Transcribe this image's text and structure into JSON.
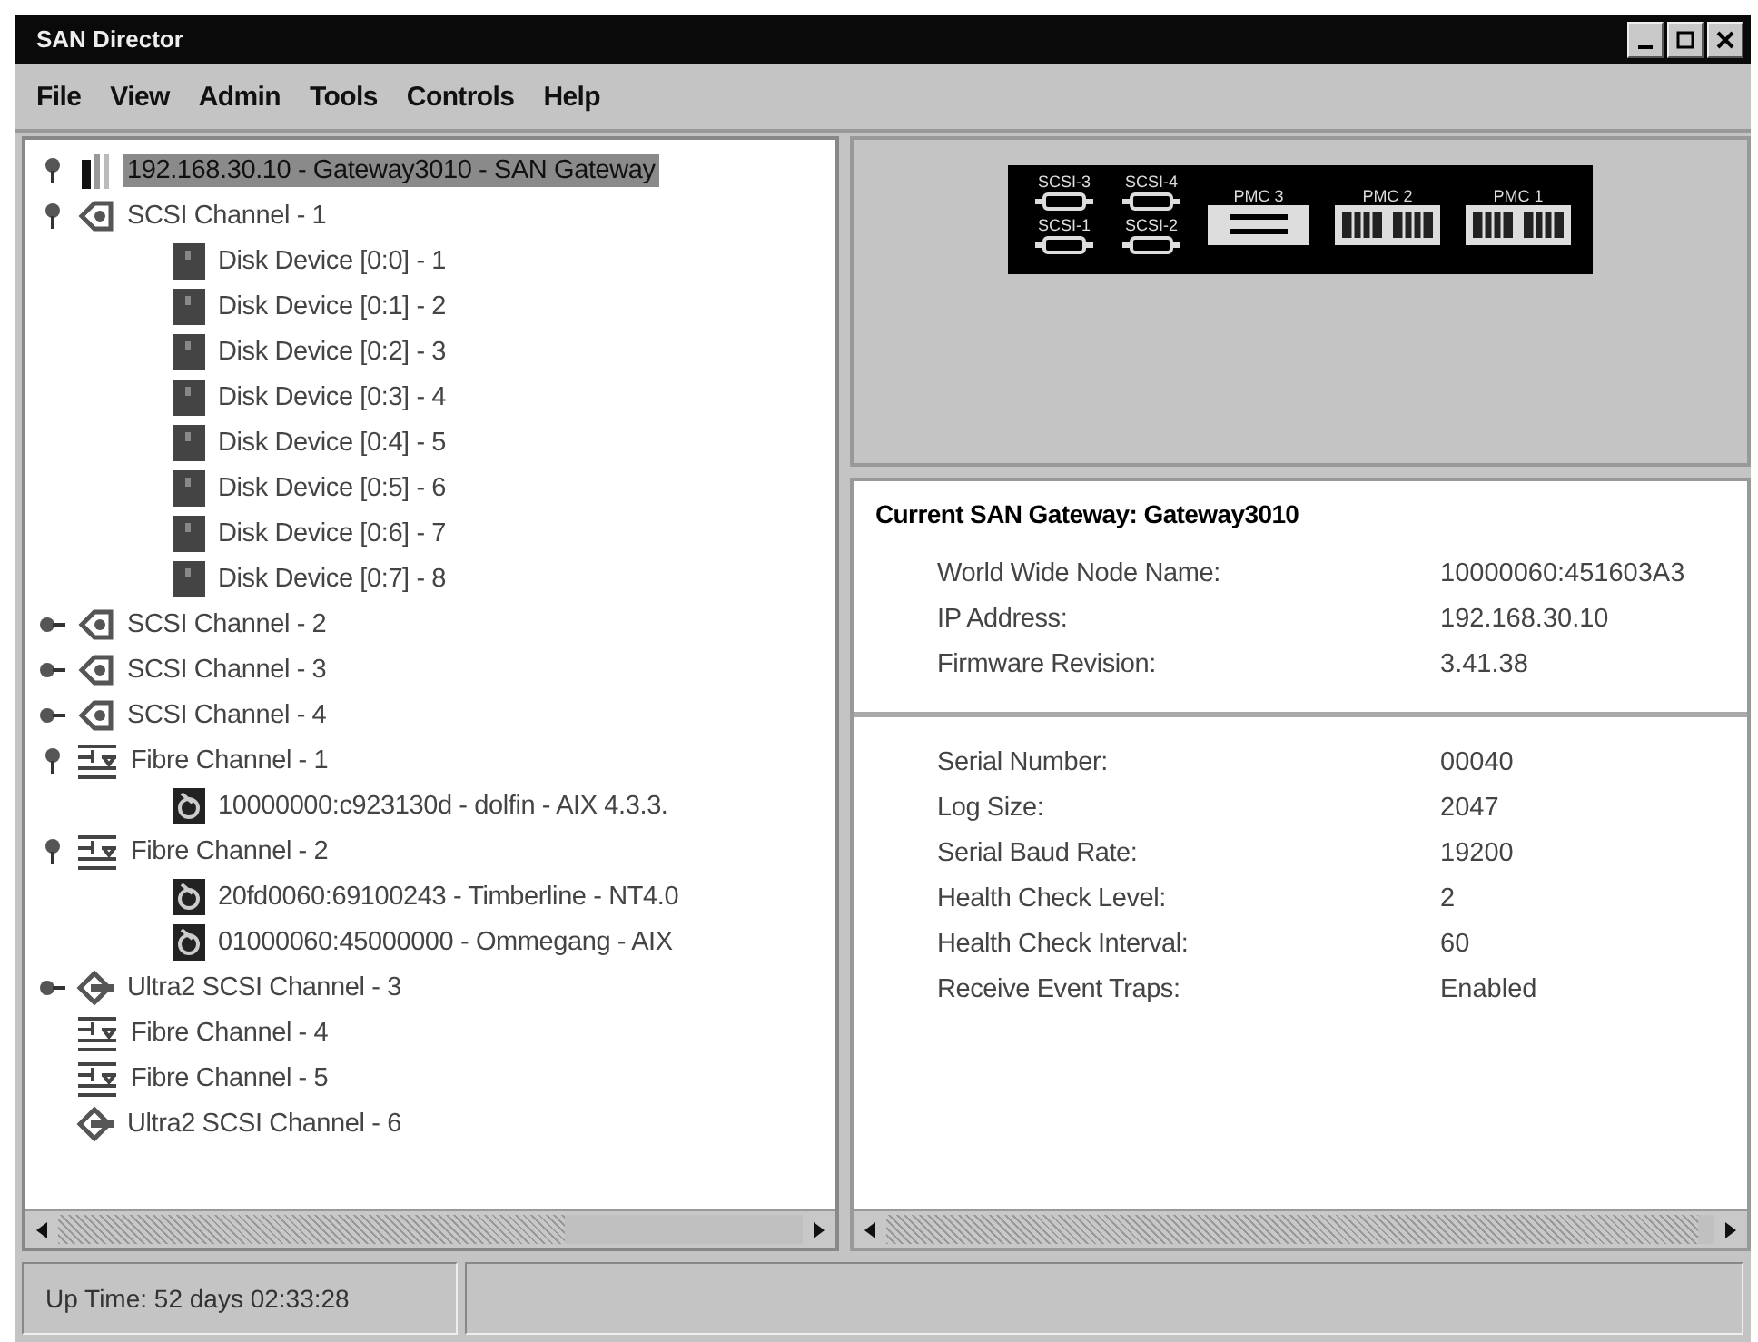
{
  "window": {
    "title": "SAN Director"
  },
  "menu": [
    "File",
    "View",
    "Admin",
    "Tools",
    "Controls",
    "Help"
  ],
  "tree": [
    {
      "kind": "gateway",
      "label": "192.168.30.10 - Gateway3010 - SAN Gateway",
      "expanded": true,
      "selected": true
    },
    {
      "kind": "scsi",
      "label": "SCSI Channel - 1",
      "expanded": true,
      "selected": false,
      "children": [
        {
          "kind": "disk",
          "label": "Disk Device [0:0] - 1",
          "selected": false
        },
        {
          "kind": "disk",
          "label": "Disk Device [0:1] - 2",
          "selected": false
        },
        {
          "kind": "disk",
          "label": "Disk Device [0:2] - 3",
          "selected": false
        },
        {
          "kind": "disk",
          "label": "Disk Device [0:3] - 4",
          "selected": false
        },
        {
          "kind": "disk",
          "label": "Disk Device [0:4] - 5",
          "selected": false
        },
        {
          "kind": "disk",
          "label": "Disk Device [0:5] - 6",
          "selected": false
        },
        {
          "kind": "disk",
          "label": "Disk Device [0:6] - 7",
          "selected": false
        },
        {
          "kind": "disk",
          "label": "Disk Device [0:7] - 8",
          "selected": false
        }
      ]
    },
    {
      "kind": "scsi",
      "label": "SCSI Channel - 2",
      "expanded": false,
      "selected": false
    },
    {
      "kind": "scsi",
      "label": "SCSI Channel - 3",
      "expanded": false,
      "selected": false
    },
    {
      "kind": "scsi",
      "label": "SCSI Channel - 4",
      "expanded": false,
      "selected": false
    },
    {
      "kind": "fibre",
      "label": "Fibre Channel - 1",
      "expanded": true,
      "selected": false,
      "children": [
        {
          "kind": "host",
          "label": "10000000:c923130d -  dolfin -   AIX 4.3.3.",
          "selected": false
        }
      ]
    },
    {
      "kind": "fibre",
      "label": "Fibre Channel - 2",
      "expanded": true,
      "selected": false,
      "children": [
        {
          "kind": "host",
          "label": "20fd0060:69100243 -  Timberline -  NT4.0",
          "selected": false
        },
        {
          "kind": "host",
          "label": "01000060:45000000 -  Ommegang  - AIX",
          "selected": false
        }
      ]
    },
    {
      "kind": "ultra2",
      "label": "Ultra2 SCSI Channel - 3",
      "expanded": false,
      "selected": false
    },
    {
      "kind": "fibre",
      "label": "Fibre Channel - 4",
      "selected": false
    },
    {
      "kind": "fibre",
      "label": "Fibre Channel - 5",
      "selected": false
    },
    {
      "kind": "ultra2",
      "label": "Ultra2 SCSI Channel - 6",
      "selected": false
    }
  ],
  "device_panel": {
    "ports": [
      {
        "kind": "scsi",
        "label": "SCSI-3"
      },
      {
        "kind": "scsi",
        "label": "SCSI-4"
      },
      {
        "kind": "scsi",
        "label": "SCSI-1"
      },
      {
        "kind": "scsi",
        "label": "SCSI-2"
      },
      {
        "kind": "pmc_serial",
        "label": "PMC 3"
      },
      {
        "kind": "pmc_fibre",
        "label": "PMC 2"
      },
      {
        "kind": "pmc_fibre",
        "label": "PMC 1"
      }
    ]
  },
  "details": {
    "title": "Current SAN Gateway:  Gateway3010",
    "sections": [
      [
        {
          "label": "World Wide Node Name:",
          "value": "10000060:451603A3"
        },
        {
          "label": "IP Address:",
          "value": "192.168.30.10"
        },
        {
          "label": "Firmware Revision:",
          "value": "3.41.38"
        }
      ],
      [
        {
          "label": "Serial Number:",
          "value": "00040"
        },
        {
          "label": "Log Size:",
          "value": "2047"
        },
        {
          "label": "Serial Baud Rate:",
          "value": "19200"
        },
        {
          "label": "Health Check Level:",
          "value": "2"
        },
        {
          "label": "Health Check Interval:",
          "value": "60"
        },
        {
          "label": "Receive Event Traps:",
          "value": "Enabled"
        }
      ]
    ]
  },
  "status_bar": [
    "Up Time: 52 days 02:33:28"
  ]
}
